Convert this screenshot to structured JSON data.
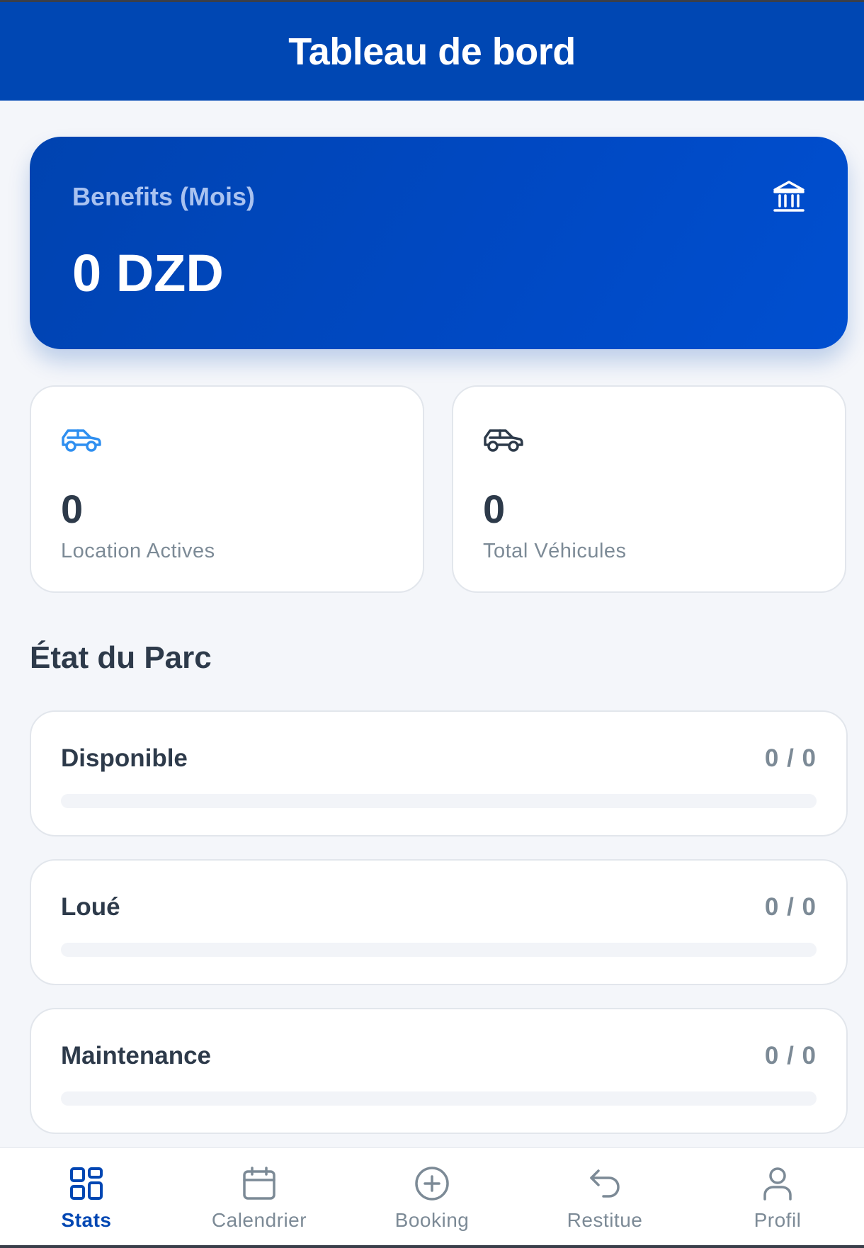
{
  "header": {
    "title": "Tableau de bord"
  },
  "benefits": {
    "label": "Benefits (Mois)",
    "value": "0 DZD",
    "icon": "bank-icon"
  },
  "stats": [
    {
      "value": "0",
      "label": "Location Actives",
      "icon": "car-icon",
      "icon_color": "#2f8ff0"
    },
    {
      "value": "0",
      "label": "Total Véhicules",
      "icon": "car-icon",
      "icon_color": "#2d3a4a"
    }
  ],
  "fleet": {
    "title": "État du Parc",
    "items": [
      {
        "name": "Disponible",
        "ratio": "0 / 0",
        "progress": 0
      },
      {
        "name": "Loué",
        "ratio": "0 / 0",
        "progress": 0
      },
      {
        "name": "Maintenance",
        "ratio": "0 / 0",
        "progress": 0
      }
    ]
  },
  "nav": {
    "items": [
      {
        "label": "Stats",
        "icon": "grid-icon",
        "active": true
      },
      {
        "label": "Calendrier",
        "icon": "calendar-icon",
        "active": false
      },
      {
        "label": "Booking",
        "icon": "plus-circle-icon",
        "active": false
      },
      {
        "label": "Restitue",
        "icon": "undo-icon",
        "active": false
      },
      {
        "label": "Profil",
        "icon": "user-icon",
        "active": false
      }
    ]
  },
  "colors": {
    "primary": "#0047b3",
    "accent_blue": "#2f8ff0",
    "text_dark": "#2d3a4a",
    "text_muted": "#7c8a96",
    "background": "#f4f6fa"
  }
}
